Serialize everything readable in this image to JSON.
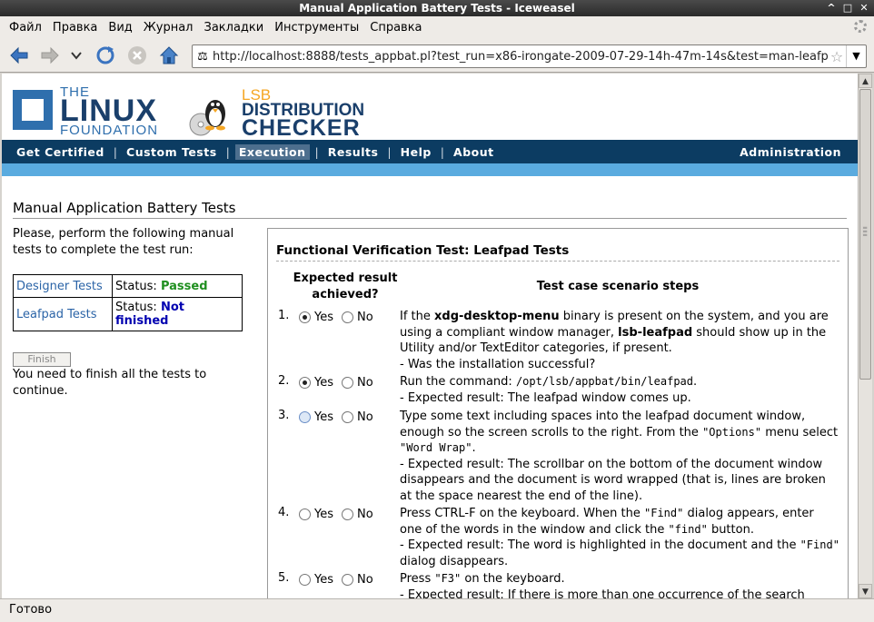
{
  "window": {
    "title": "Manual Application Battery Tests - Iceweasel",
    "controls": [
      "^",
      "□",
      "✕"
    ]
  },
  "menu": [
    "Файл",
    "Правка",
    "Вид",
    "Журнал",
    "Закладки",
    "Инструменты",
    "Справка"
  ],
  "nav": {
    "url": "http://localhost:8888/tests_appbat.pl?test_run=x86-irongate-2009-07-29-14h-47m-14s&test=man-leafpad"
  },
  "brand": {
    "lf_the": "THE",
    "lf_linux": "LINUX",
    "lf_foundation": "FOUNDATION",
    "lsb_lsb": "LSB",
    "lsb_distribution": "DISTRIBUTION",
    "lsb_checker": "CHECKER"
  },
  "sitenav": {
    "items": [
      "Get Certified",
      "Custom Tests",
      "Execution",
      "Results",
      "Help",
      "About"
    ],
    "active": "Execution",
    "admin": "Administration"
  },
  "page": {
    "title": "Manual Application Battery Tests",
    "intro": "Please, perform the following manual tests to complete the test run:",
    "status_rows": [
      {
        "name": "Designer Tests",
        "status_label": "Status:",
        "status": "Passed"
      },
      {
        "name": "Leafpad Tests",
        "status_label": "Status:",
        "status": "Not finished"
      }
    ],
    "finish_label": "Finish",
    "finish_note": "You need to finish all the tests to continue."
  },
  "panel": {
    "title": "Functional Verification Test: Leafpad Tests",
    "col_expected": "Expected result achieved?",
    "col_steps": "Test case scenario steps",
    "yes": "Yes",
    "no": "No",
    "rows": [
      {
        "num": "1.",
        "selected": "yes",
        "parts": [
          {
            "t": "If the "
          },
          {
            "t": "xdg-desktop-menu",
            "b": true
          },
          {
            "t": " binary is present on the system, and you are using a compliant window manager, "
          },
          {
            "t": "lsb-leafpad",
            "b": true
          },
          {
            "t": " should show up in the Utility and/or TextEditor categories, if present."
          },
          {
            "br": true
          },
          {
            "t": "- Was the installation successful?"
          }
        ]
      },
      {
        "num": "2.",
        "selected": "yes",
        "parts": [
          {
            "t": "Run the command: "
          },
          {
            "t": "/opt/lsb/appbat/bin/leafpad",
            "m": true
          },
          {
            "t": "."
          },
          {
            "br": true
          },
          {
            "t": "- Expected result: The leafpad window comes up."
          }
        ]
      },
      {
        "num": "3.",
        "selected": "focus",
        "parts": [
          {
            "t": "Type some text including spaces into the leafpad document window, enough so the screen scrolls to the right. From the "
          },
          {
            "t": "\"Options\"",
            "m": true
          },
          {
            "t": " menu select "
          },
          {
            "t": "\"Word Wrap\"",
            "m": true
          },
          {
            "t": "."
          },
          {
            "br": true
          },
          {
            "t": "- Expected result: The scrollbar on the bottom of the document window disappears and the document is word wrapped (that is, lines are broken at the space nearest the end of the line)."
          }
        ]
      },
      {
        "num": "4.",
        "selected": "none",
        "parts": [
          {
            "t": "Press CTRL-F on the keyboard. When the "
          },
          {
            "t": "\"Find\"",
            "m": true
          },
          {
            "t": " dialog appears, enter one of the words in the window and click the "
          },
          {
            "t": "\"find\"",
            "m": true
          },
          {
            "t": " button."
          },
          {
            "br": true
          },
          {
            "t": "- Expected result: The word is highlighted in the document and the "
          },
          {
            "t": "\"Find\"",
            "m": true
          },
          {
            "t": " dialog disappears."
          }
        ]
      },
      {
        "num": "5.",
        "selected": "none",
        "parts": [
          {
            "t": "Press "
          },
          {
            "t": "\"F3\"",
            "m": true
          },
          {
            "t": " on the keyboard."
          },
          {
            "br": true
          },
          {
            "t": "- Expected result: If there is more than one occurrence of the search string,"
          }
        ]
      }
    ]
  },
  "status_text": "Готово"
}
